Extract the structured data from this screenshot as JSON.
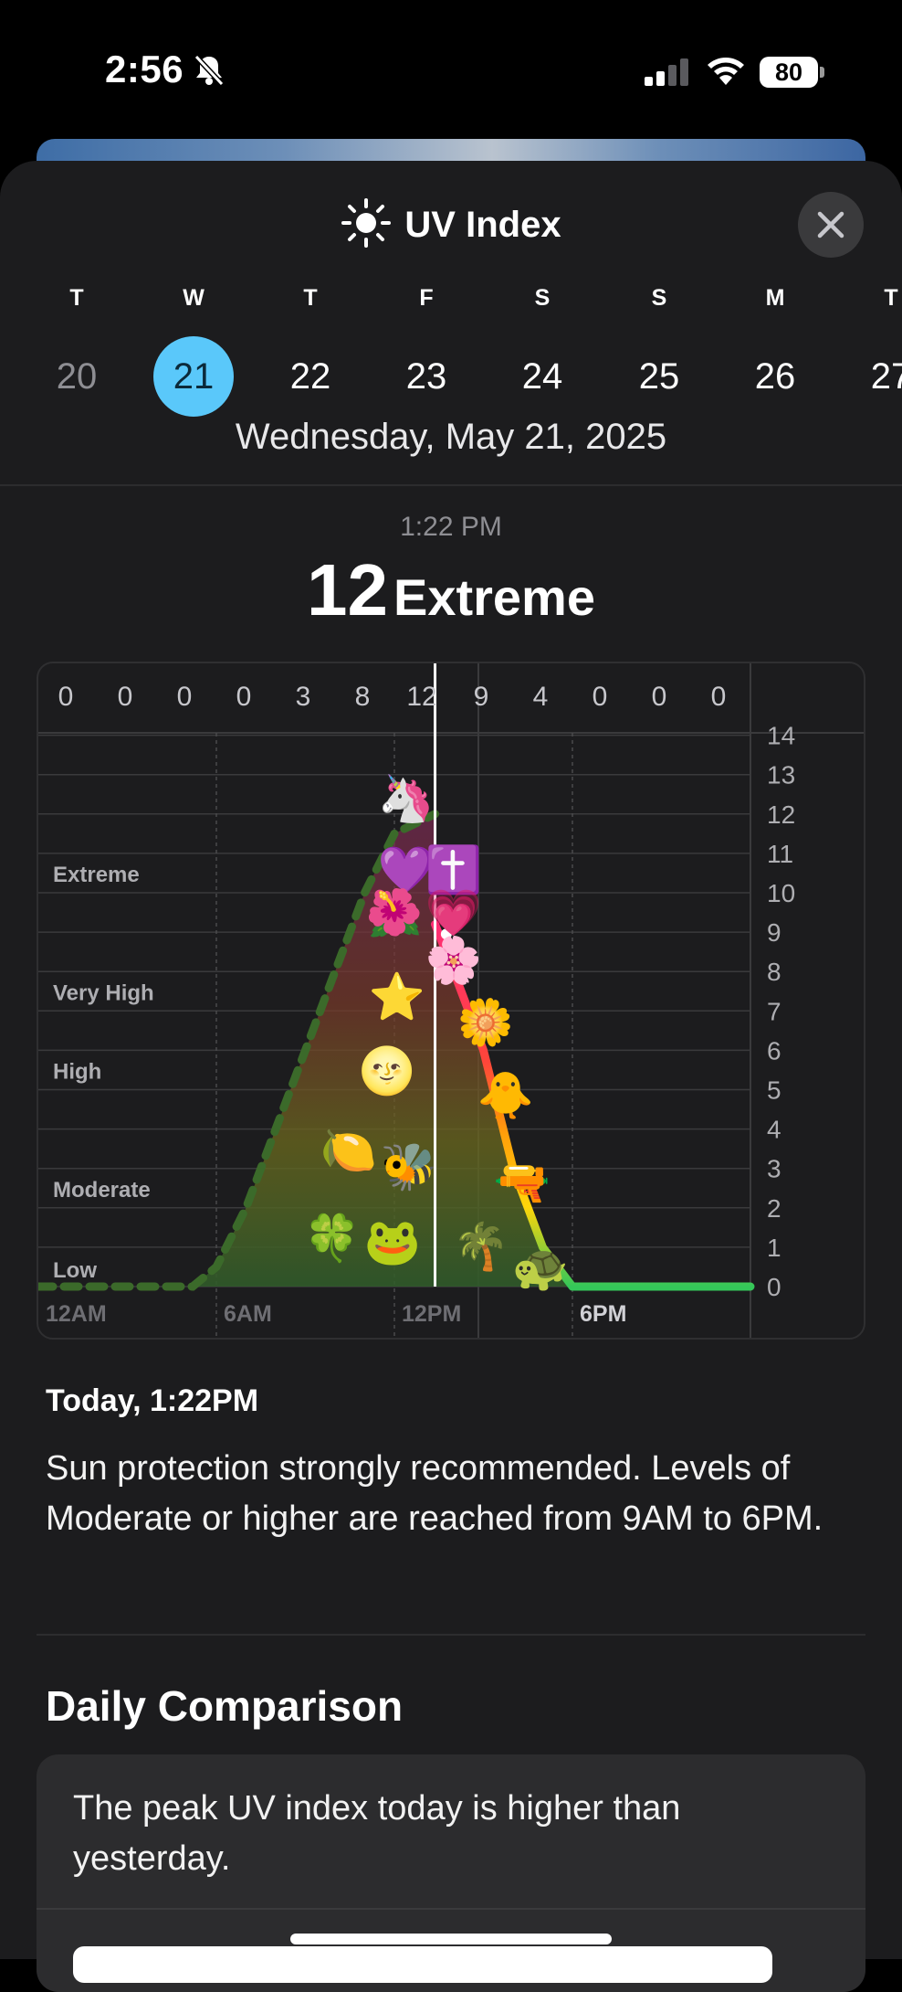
{
  "status_bar": {
    "time": "2:56",
    "battery": "80"
  },
  "sheet": {
    "title": "UV Index"
  },
  "days": [
    {
      "letter": "T",
      "num": "20",
      "state": "past"
    },
    {
      "letter": "W",
      "num": "21",
      "state": "selected"
    },
    {
      "letter": "T",
      "num": "22",
      "state": "future"
    },
    {
      "letter": "F",
      "num": "23",
      "state": "future"
    },
    {
      "letter": "S",
      "num": "24",
      "state": "future"
    },
    {
      "letter": "S",
      "num": "25",
      "state": "future"
    },
    {
      "letter": "M",
      "num": "26",
      "state": "future"
    },
    {
      "letter": "T",
      "num": "27",
      "state": "future"
    }
  ],
  "date_full": "Wednesday, May 21, 2025",
  "current": {
    "time": "1:22 PM",
    "value": "12",
    "category": "Extreme"
  },
  "chart_data": {
    "type": "area",
    "top_labels": [
      "0",
      "0",
      "0",
      "0",
      "3",
      "8",
      "12",
      "9",
      "4",
      "0",
      "0",
      "0"
    ],
    "x_labels": [
      "12AM",
      "6AM",
      "12PM",
      "6PM"
    ],
    "y_ticks": [
      "0",
      "1",
      "2",
      "3",
      "4",
      "5",
      "6",
      "7",
      "8",
      "9",
      "10",
      "11",
      "12",
      "13",
      "14"
    ],
    "ylim": [
      0,
      14
    ],
    "categories": [
      {
        "name": "Low",
        "y": 0
      },
      {
        "name": "Moderate",
        "y": 2
      },
      {
        "name": "High",
        "y": 5
      },
      {
        "name": "Very High",
        "y": 7
      },
      {
        "name": "Extreme",
        "y": 10
      }
    ],
    "series": [
      {
        "name": "",
        "x_hours": [
          0,
          5.2,
          6,
          7,
          8,
          9,
          10,
          11,
          12,
          13.37
        ],
        "values": [
          0,
          0,
          0.5,
          2,
          4,
          6,
          8,
          10,
          11.5,
          12
        ],
        "style": "dashed-past"
      },
      {
        "name": "",
        "x_hours": [
          13.37,
          14,
          15,
          16,
          17,
          18
        ],
        "values": [
          9.2,
          8,
          6,
          3,
          1,
          0
        ],
        "style": "forecast"
      }
    ],
    "current_hour": 13.37,
    "colors": {
      "low": "#34c759",
      "moderate": "#ffd60a",
      "high": "#ff9f0a",
      "very_high": "#ff453a",
      "extreme": "#ff2d75"
    }
  },
  "today_heading": "Today, 1:22PM",
  "description": "Sun protection strongly recommended. Levels of Moderate or higher are reached from 9AM to 6PM.",
  "comparison": {
    "title": "Daily Comparison",
    "text": "The peak UV index today is higher than yesterday."
  }
}
